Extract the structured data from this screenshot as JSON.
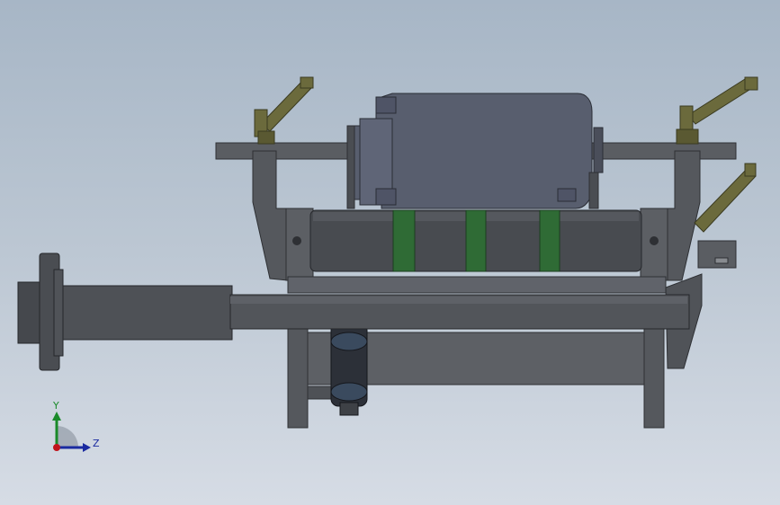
{
  "viewport": {
    "background_top": "#a7b6c6",
    "background_bottom": "#d6dce5"
  },
  "model": {
    "parts": [
      "clamp-lever-left",
      "clamp-lever-right-upper",
      "clamp-lever-right-lower",
      "motor-housing",
      "top-crossbar",
      "main-frame",
      "roller",
      "roller-bands",
      "main-shaft",
      "shaft-flange",
      "lower-frame",
      "pneumatic-cylinder",
      "bracket-right"
    ],
    "colors": {
      "frame": "#55585d",
      "frame_dark": "#3e4146",
      "motor": "#585e6e",
      "roller": "#484b50",
      "band": "#2f6b35",
      "lever": "#6b6a3c",
      "shaft": "#4e5156"
    }
  },
  "triad": {
    "y_label": "Y",
    "z_label": "Z",
    "y_color": "#1a8a2a",
    "z_color": "#1a2aa0",
    "x_color": "#c0141c"
  }
}
